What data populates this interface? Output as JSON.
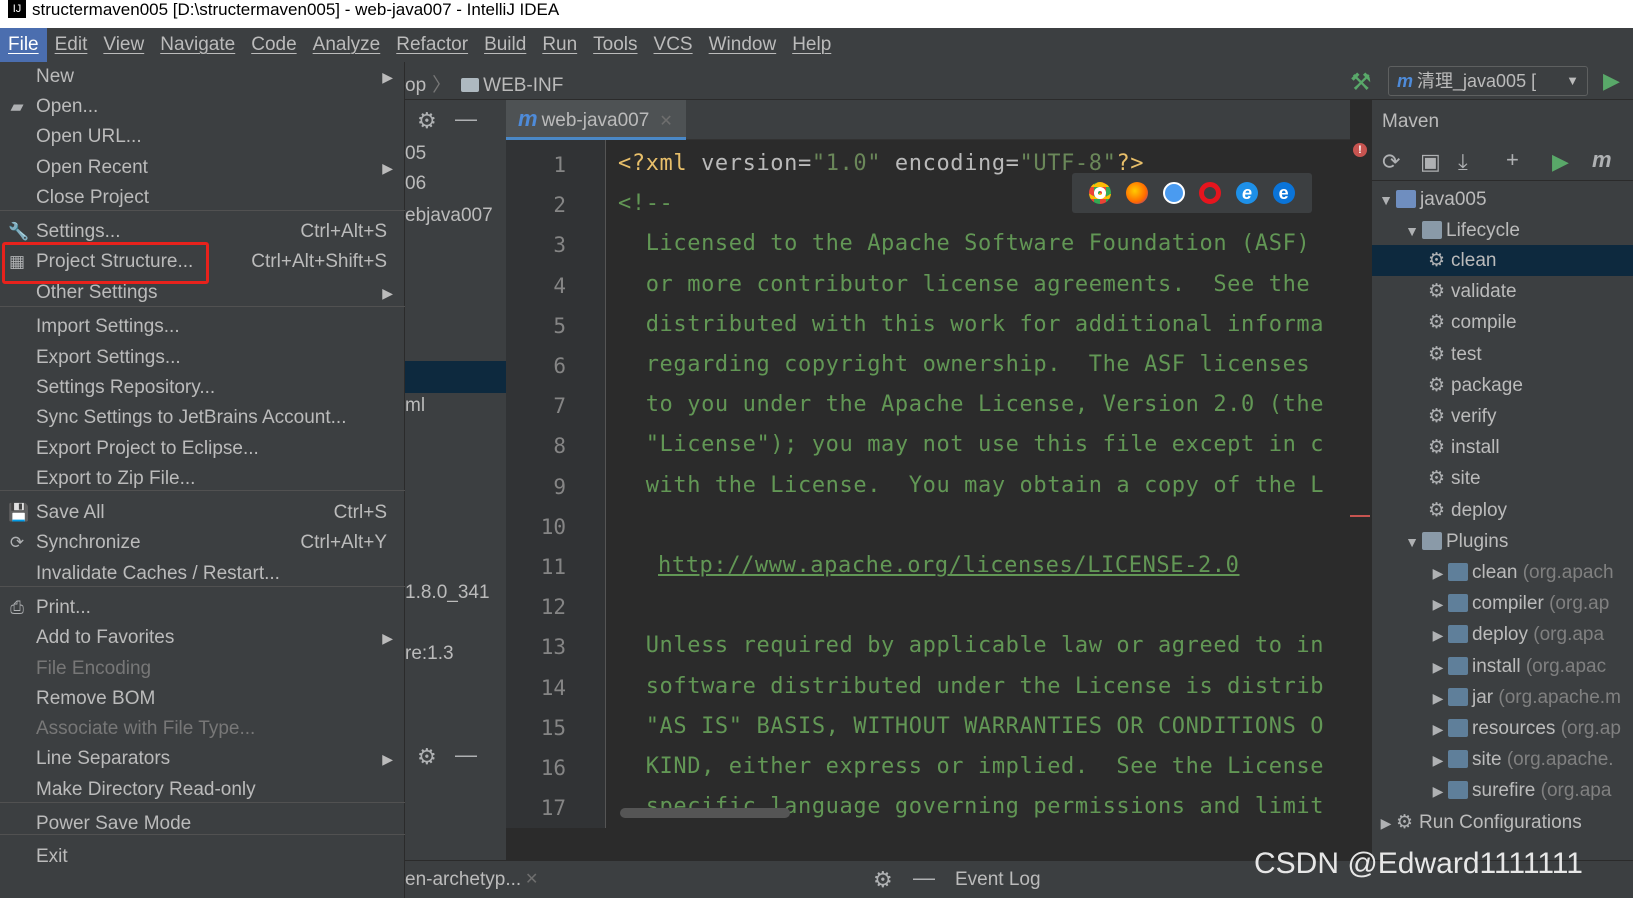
{
  "window": {
    "title": "structermaven005 [D:\\structermaven005] - web-java007 - IntelliJ IDEA",
    "app_icon": "IJ"
  },
  "menubar": [
    "File",
    "Edit",
    "View",
    "Navigate",
    "Code",
    "Analyze",
    "Refactor",
    "Build",
    "Run",
    "Tools",
    "VCS",
    "Window",
    "Help"
  ],
  "navbar": {
    "breadcrumb_prefix": "op",
    "breadcrumb_folder": "WEB-INF",
    "run_config_label": "清理_java005 [",
    "run_config_icon": "maven-m-icon"
  },
  "file_menu": {
    "items": [
      {
        "label": "New",
        "submenu": true
      },
      {
        "label": "Open...",
        "icon": "folder-open-icon"
      },
      {
        "label": "Open URL..."
      },
      {
        "label": "Open Recent",
        "submenu": true
      },
      {
        "label": "Close Project"
      },
      {
        "label": "Settings...",
        "shortcut": "Ctrl+Alt+S",
        "icon": "wrench-icon"
      },
      {
        "label": "Project Structure...",
        "shortcut": "Ctrl+Alt+Shift+S",
        "icon": "project-structure-icon"
      },
      {
        "label": "Other Settings",
        "submenu": true
      },
      {
        "label": "Import Settings..."
      },
      {
        "label": "Export Settings..."
      },
      {
        "label": "Settings Repository..."
      },
      {
        "label": "Sync Settings to JetBrains Account..."
      },
      {
        "label": "Export Project to Eclipse..."
      },
      {
        "label": "Export to Zip File..."
      },
      {
        "label": "Save All",
        "shortcut": "Ctrl+S",
        "icon": "save-icon"
      },
      {
        "label": "Synchronize",
        "shortcut": "Ctrl+Alt+Y",
        "icon": "sync-icon"
      },
      {
        "label": "Invalidate Caches / Restart..."
      },
      {
        "label": "Print...",
        "icon": "print-icon"
      },
      {
        "label": "Add to Favorites",
        "submenu": true
      },
      {
        "label": "File Encoding",
        "disabled": true
      },
      {
        "label": "Remove BOM"
      },
      {
        "label": "Associate with File Type...",
        "disabled": true
      },
      {
        "label": "Line Separators",
        "submenu": true
      },
      {
        "label": "Make Directory Read-only"
      },
      {
        "label": "Power Save Mode"
      },
      {
        "label": "Exit"
      }
    ]
  },
  "left_panel": {
    "fragments": [
      "05",
      "06",
      "ebjava007",
      "ml",
      "1.8.0_341",
      "re:1.3"
    ],
    "bottom_tab": "en-archetyp..."
  },
  "editor": {
    "tab_label": "web-java007",
    "line_numbers": [
      "1",
      "2",
      "3",
      "4",
      "5",
      "6",
      "7",
      "8",
      "9",
      "10",
      "11",
      "12",
      "13",
      "14",
      "15",
      "16",
      "17"
    ],
    "xml_decl": {
      "open": "<?xml ",
      "attr1": "version=",
      "val1": "\"1.0\"",
      "attr2": " encoding=",
      "val2": "\"UTF-8\"",
      "close": "?>"
    },
    "lines": [
      "<!--",
      "  Licensed to the Apache Software Foundation (ASF)",
      "  or more contributor license agreements.  See the",
      "  distributed with this work for additional informa",
      "  regarding copyright ownership.  The ASF licenses",
      "  to you under the Apache License, Version 2.0 (the",
      "  \"License\"); you may not use this file except in c",
      "  with the License.  You may obtain a copy of the L",
      "",
      "",
      "",
      "  Unless required by applicable law or agreed to in",
      "  software distributed under the License is distrib",
      "  \"AS IS\" BASIS, WITHOUT WARRANTIES OR CONDITIONS O",
      "  KIND, either express or implied.  See the License",
      "  specific language governing permissions and limit"
    ],
    "url_line": "http://www.apache.org/licenses/LICENSE-2.0",
    "browser_icons": [
      "chrome-icon",
      "firefox-icon",
      "safari-icon",
      "opera-icon",
      "ie-icon",
      "edge-icon"
    ],
    "colors": {
      "comment": "#629755",
      "background": "#2b2b2b",
      "gutter": "#313335"
    }
  },
  "maven": {
    "title": "Maven",
    "root": "java005",
    "lifecycle_label": "Lifecycle",
    "lifecycle": [
      "clean",
      "validate",
      "compile",
      "test",
      "package",
      "verify",
      "install",
      "site",
      "deploy"
    ],
    "plugins_label": "Plugins",
    "plugins": [
      {
        "name": "clean",
        "group": " (org.apach"
      },
      {
        "name": "compiler",
        "group": " (org.ap"
      },
      {
        "name": "deploy",
        "group": " (org.apa"
      },
      {
        "name": "install",
        "group": " (org.apac"
      },
      {
        "name": "jar",
        "group": " (org.apache.m"
      },
      {
        "name": "resources",
        "group": " (org.ap"
      },
      {
        "name": "site",
        "group": " (org.apache."
      },
      {
        "name": "surefire",
        "group": " (org.apa"
      }
    ],
    "run_configs_label": "Run Configurations",
    "selected": "clean"
  },
  "bottom": {
    "event_log": "Event Log"
  },
  "watermark": "CSDN @Edward1111111",
  "accent": {
    "highlight_box": "#e8221c",
    "selection": "#0d293e",
    "menu_active": "#4b6eaf"
  }
}
